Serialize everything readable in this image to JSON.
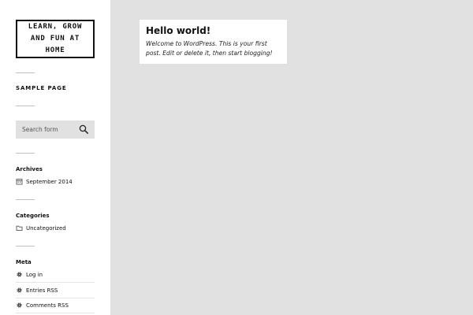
{
  "site": {
    "title": "LEARN, GROW AND FUN AT HOME"
  },
  "nav": {
    "sample_page": "SAMPLE PAGE"
  },
  "search": {
    "placeholder": "Search form"
  },
  "icons": {
    "search": "search-icon",
    "archive": "calendar-icon",
    "category": "folder-icon",
    "meta": "gear-icon"
  },
  "archives": {
    "title": "Archives",
    "items": [
      {
        "label": "September 2014"
      }
    ]
  },
  "categories": {
    "title": "Categories",
    "items": [
      {
        "label": "Uncategorized"
      }
    ]
  },
  "meta": {
    "title": "Meta",
    "items": [
      {
        "label": "Log in"
      },
      {
        "label": "Entries RSS"
      },
      {
        "label": "Comments RSS"
      }
    ]
  },
  "post": {
    "title": "Hello world!",
    "excerpt": "Welcome to WordPress. This is your first post. Edit or delete it, then start blogging!"
  },
  "colors": {
    "background": "#e1e1e1",
    "sidebar": "#ffffff",
    "text": "#111111"
  }
}
